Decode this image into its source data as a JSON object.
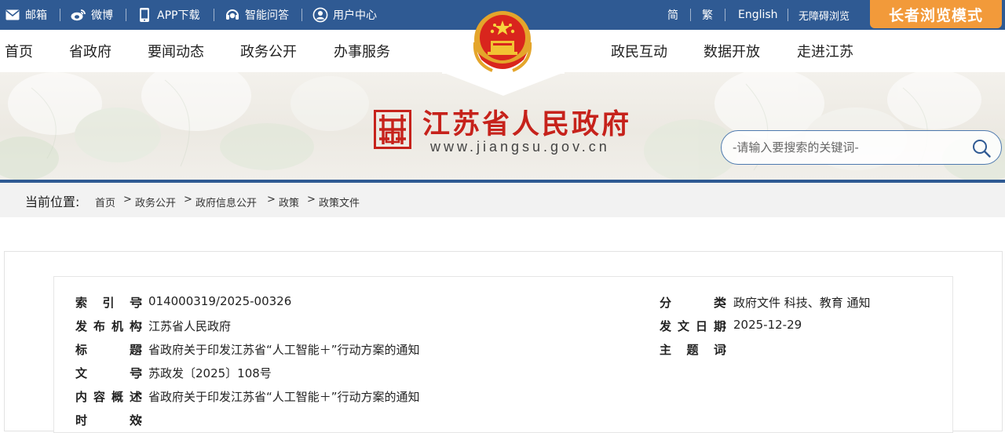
{
  "topbar": {
    "mail": "邮箱",
    "weibo": "微博",
    "app": "APP下载",
    "qa": "智能问答",
    "user": "用户中心",
    "simplified": "简",
    "traditional": "繁",
    "english": "English",
    "accessible": "无障碍浏览",
    "elder_mode": "长者浏览模式",
    "colors": {
      "bar": "#2f5a93",
      "elder": "#f29a3a"
    }
  },
  "nav": {
    "left": [
      "首页",
      "省政府",
      "要闻动态",
      "政务公开",
      "办事服务"
    ],
    "right": [
      "政民互动",
      "数据开放",
      "走进江苏"
    ]
  },
  "banner": {
    "title": "江苏省人民政府",
    "url": "www.jiangsu.gov.cn",
    "search_placeholder": "-请输入要搜索的关键词-",
    "title_color": "#c6221b"
  },
  "breadcrumb": {
    "label": "当前位置:",
    "items": [
      "首页",
      "政务公开",
      "政府信息公开",
      "政策",
      "政策文件"
    ],
    "separator": ">"
  },
  "meta": {
    "index_label": "索引号",
    "index_value": "014000319/2025-00326",
    "issuer_label": "发布机构",
    "issuer_value": "江苏省人民政府",
    "title_label": "标题",
    "title_value": "省政府关于印发江苏省“人工智能＋”行动方案的通知",
    "docno_label": "文号",
    "docno_value": "苏政发〔2025〕108号",
    "summary_label": "内容概述",
    "summary_value": "省政府关于印发江苏省“人工智能＋”行动方案的通知",
    "validity_label": "时效",
    "category_label": "分类",
    "category_value": "政府文件 科技、教育 通知",
    "date_label": "发文日期",
    "date_value": "2025-12-29",
    "subject_label": "主题词",
    "colon": ":"
  }
}
